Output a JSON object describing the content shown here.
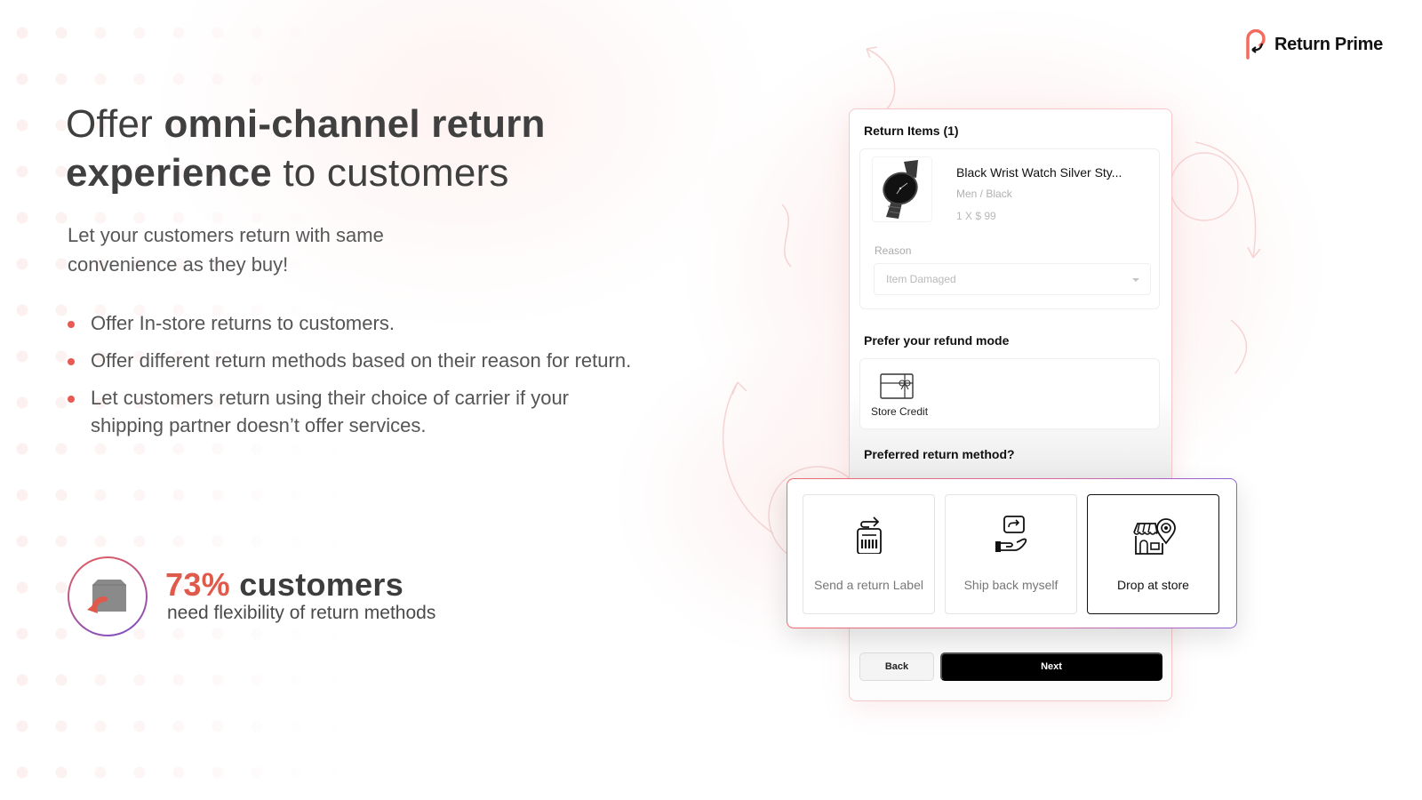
{
  "brand": {
    "name": "Return Prime",
    "accent": "#f46b5d"
  },
  "hero": {
    "title_pre": "Offer ",
    "title_bold_1": "omni-channel return",
    "title_bold_2": "experience",
    "title_post": " to customers",
    "subtitle": "Let your customers return with same convenience as they buy!",
    "bullets": [
      "Offer In-store returns to customers.",
      "Offer different return methods based on their reason for return.",
      "Let customers return using their choice of carrier if your shipping partner doesn’t offer services."
    ],
    "bullet_color": "#e85a52"
  },
  "stat": {
    "icon": "box-return-icon",
    "percent": "73%",
    "headline_rest": " customers",
    "caption": "need flexibility of return methods"
  },
  "return_form": {
    "items_title": "Return Items (1)",
    "item": {
      "name": "Black Wrist Watch Silver Sty...",
      "variant": "Men / Black",
      "price": "1 X $ 99",
      "image": "black-wrist-watch"
    },
    "reason_label": "Reason",
    "reason_value": "Item Damaged",
    "refund_title": "Prefer your refund mode",
    "refund_option": {
      "label": "Store Credit",
      "icon": "gift-card-icon"
    },
    "method_title": "Preferred return method?",
    "methods": [
      {
        "label": "Send a return Label",
        "icon": "return-label-icon",
        "selected": false
      },
      {
        "label": "Ship back myself",
        "icon": "hand-package-icon",
        "selected": false
      },
      {
        "label": "Drop at store",
        "icon": "store-location-icon",
        "selected": true
      }
    ],
    "back_label": "Back",
    "next_label": "Next"
  }
}
